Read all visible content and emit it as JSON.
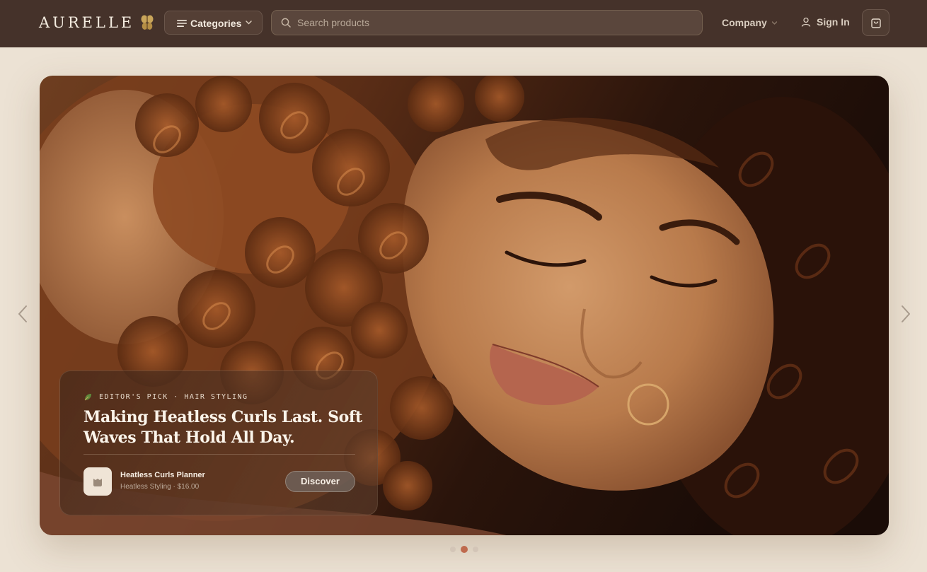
{
  "header": {
    "brand": "AURELLE",
    "categories_label": "Categories",
    "search_placeholder": "Search products",
    "company_label": "Company",
    "signin_label": "Sign In"
  },
  "hero": {
    "eyebrow": "EDITOR'S PICK · HAIR STYLING",
    "title": "Making Heatless Curls Last. Soft Waves That Hold All Day.",
    "product": {
      "name": "Heatless Curls Planner",
      "meta": "Heatless Styling · $16.00"
    },
    "cta_label": "Discover"
  },
  "carousel": {
    "slide_count": 3,
    "active_slide": 2
  },
  "colors": {
    "nav_bg": "#45322a",
    "page_bg": "#ece2d4",
    "accent": "#bf6a4e"
  },
  "icons": [
    "butterfly-logo-icon",
    "menu-lines-icon",
    "chevron-down-icon",
    "search-icon",
    "user-icon",
    "shopping-bag-icon",
    "chevron-left-icon",
    "chevron-right-icon",
    "leaf-icon",
    "product-icon"
  ]
}
